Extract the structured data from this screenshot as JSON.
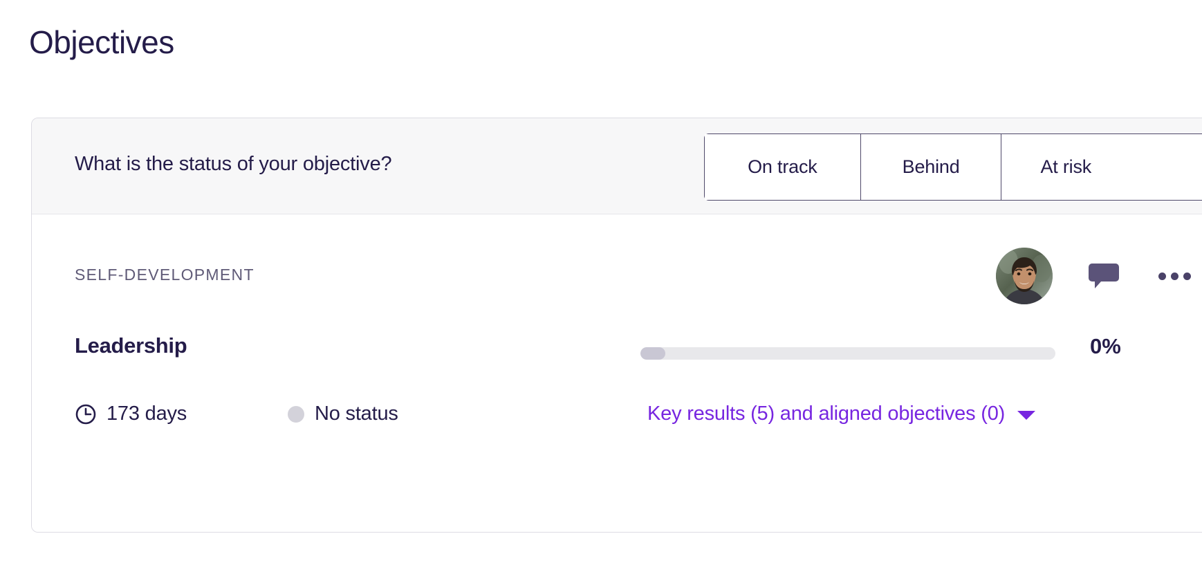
{
  "page": {
    "title": "Objectives"
  },
  "card": {
    "header": {
      "question": "What is the status of your objective?",
      "status_options": [
        {
          "label": "On track",
          "name": "on-track"
        },
        {
          "label": "Behind",
          "name": "behind"
        },
        {
          "label": "At risk",
          "name": "at-risk"
        }
      ]
    },
    "objective": {
      "category": "SELF-DEVELOPMENT",
      "name": "Leadership",
      "progress_percent_label": "0%",
      "progress_percent": 0,
      "progress_fill_width": "6%",
      "days_remaining": "173 days",
      "status": "No status",
      "expand_label": "Key results (5) and aligned objectives (0)",
      "owner_avatar_alt": "owner-avatar"
    },
    "icons": {
      "avatar": "avatar-icon",
      "comment": "comment-bubble-icon",
      "more": "more-options-icon",
      "clock": "clock-icon",
      "status_dot": "status-dot-icon",
      "caret": "chevron-down-icon"
    }
  },
  "colors": {
    "text_primary": "#241c49",
    "text_muted": "#5f5a77",
    "accent_purple": "#7726e0",
    "border": "#dcdbe3",
    "segment_border": "#4e4869",
    "header_bg": "#f7f7f8",
    "progress_track": "#e8e8eb",
    "progress_fill": "#c9c7d4",
    "status_dot": "#d3d2da"
  }
}
